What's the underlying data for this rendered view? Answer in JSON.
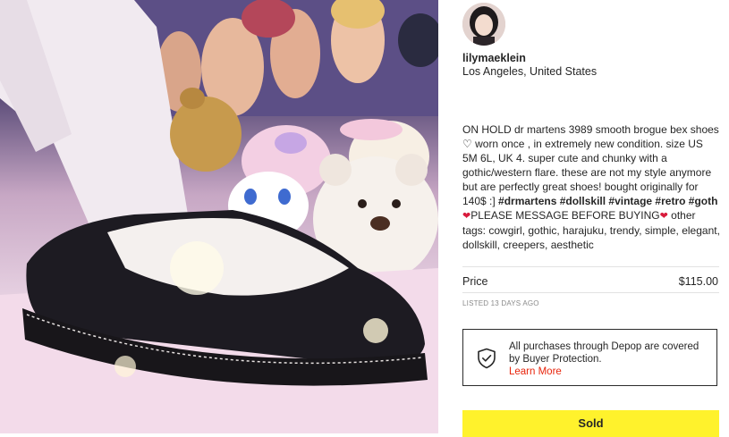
{
  "seller": {
    "username": "lilymaeklein",
    "location": "Los Angeles, United States"
  },
  "description": {
    "part1": "ON HOLD dr martens 3989 smooth brogue bex shoes ",
    "heart_outline": "♡",
    "part2": " worn once , in extremely new condition. size US 5M 6L, UK 4. super cute and chunky with a gothic/western flare. these are not my style anymore but are perfectly great shoes! bought originally for 140$ :] ",
    "tags_bold": "#drmartens #dollskill #vintage #retro #goth",
    "heart_red": "❤",
    "part3": "PLEASE MESSAGE BEFORE BUYING",
    "part4": " other tags: cowgirl, gothic, harajuku, trendy, simple, elegant, dollskill, creepers, aesthetic"
  },
  "price": {
    "label": "Price",
    "value": "$115.00"
  },
  "listed": "LISTED 13 DAYS AGO",
  "buyer_protection": {
    "text": "All purchases through Depop are covered by Buyer Protection.",
    "link": "Learn More"
  },
  "sold_button": "Sold",
  "colors": {
    "sold_bg": "#fff22c",
    "link": "#e8250c",
    "heart": "#d81b3c"
  },
  "icons": {
    "shield": "shield-check-icon"
  }
}
